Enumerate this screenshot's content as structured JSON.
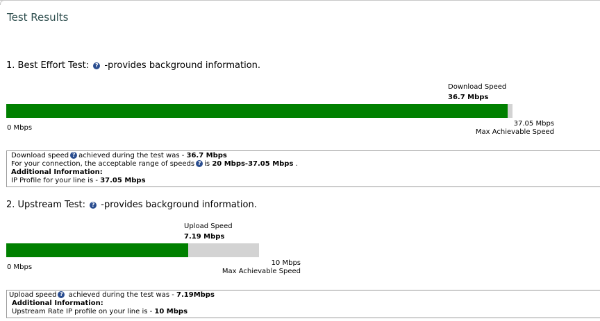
{
  "page": {
    "title": "Test Results"
  },
  "best_effort": {
    "heading_prefix": "1. Best Effort Test:",
    "heading_suffix": "-provides background information.",
    "speed_label": "Download Speed",
    "speed_value": "36.7 Mbps",
    "min_label": "0 Mbps",
    "max_value_label": "37.05 Mbps",
    "max_caption": "Max Achievable Speed",
    "fill_fraction": 0.9906,
    "info": {
      "line1_a": "Download speed",
      "line1_b": "achieved during the test was - ",
      "line1_value": "36.7 Mbps",
      "line2_a": "For your connection, the acceptable range of speeds",
      "line2_b": "is ",
      "line2_value": "20 Mbps-37.05 Mbps",
      "line2_end": " .",
      "additional": "Additional Information:",
      "line4_a": "IP Profile for your line is - ",
      "line4_value": "37.05 Mbps"
    }
  },
  "upstream": {
    "heading_prefix": "2. Upstream Test:",
    "heading_suffix": "-provides background information.",
    "speed_label": "Upload Speed",
    "speed_value": "7.19 Mbps",
    "min_label": "0 Mbps",
    "max_value_label": "10 Mbps",
    "max_caption": "Max Achievable Speed",
    "fill_fraction": 0.719,
    "info": {
      "line1_a": "Upload speed",
      "line1_b": " achieved during the test was - ",
      "line1_value": "7.19Mbps",
      "additional": "Additional Information:",
      "line3_a": "Upstream Rate IP profile on your line is - ",
      "line3_value": "10 Mbps"
    }
  },
  "help_icon_glyph": "?",
  "colors": {
    "bar_fill": "#008000",
    "bar_track": "#d3d3d3",
    "title": "#2f4f4f",
    "help_icon": "#2a4d8f"
  }
}
